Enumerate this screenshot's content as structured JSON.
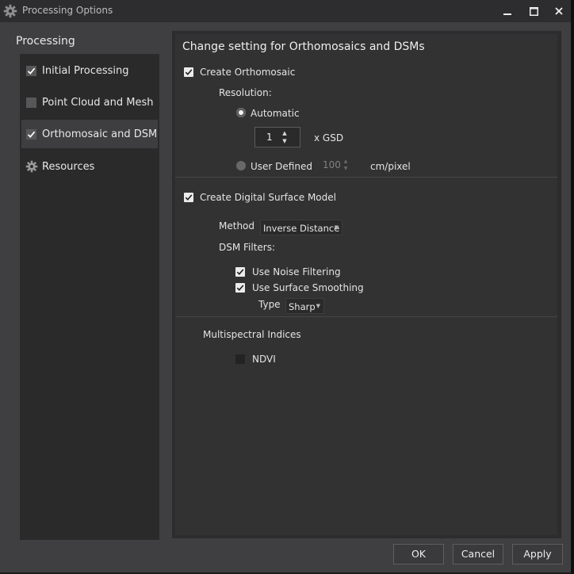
{
  "window": {
    "title": "Processing Options",
    "controls": [
      "minimize-icon",
      "maximize-icon",
      "close-icon"
    ]
  },
  "sidebar": {
    "header": "Processing",
    "items": [
      {
        "label": "Initial Processing",
        "checked": true,
        "icon": "checkbox"
      },
      {
        "label": "Point Cloud and Mesh",
        "checked": false,
        "icon": "checkbox"
      },
      {
        "label": "Orthomosaic and DSM",
        "checked": true,
        "icon": "checkbox",
        "selected": true
      },
      {
        "label": "Resources",
        "icon": "gear-icon"
      }
    ]
  },
  "main": {
    "title": "Change setting for Orthomosaics and DSMs",
    "ortho": {
      "create_label": "Create Orthomosaic",
      "create_checked": true,
      "resolution_label": "Resolution:",
      "automatic_label": "Automatic",
      "automatic_selected": true,
      "gsd_value": "1",
      "gsd_unit": "x GSD",
      "user_defined_label": "User Defined",
      "user_defined_value": "100",
      "user_defined_unit": "cm/pixel"
    },
    "dsm": {
      "create_label": "Create Digital Surface Model",
      "create_checked": true,
      "method_label": "Method",
      "method_value": "Inverse Distance",
      "filters_label": "DSM Filters:",
      "noise_label": "Use Noise Filtering",
      "noise_checked": true,
      "smoothing_label": "Use Surface Smoothing",
      "smoothing_checked": true,
      "type_label": "Type",
      "type_value": "Sharp"
    },
    "multispectral": {
      "header": "Multispectral Indices",
      "ndvi_label": "NDVI",
      "ndvi_checked": false
    }
  },
  "footer": {
    "ok": "OK",
    "cancel": "Cancel",
    "apply": "Apply"
  },
  "colors": {
    "window_bg": "#3f3f41",
    "panel_bg": "#2a2a2b",
    "content_bg": "#323233",
    "titlebar_bg": "#2d2d30",
    "text": "#e6e6e6"
  }
}
